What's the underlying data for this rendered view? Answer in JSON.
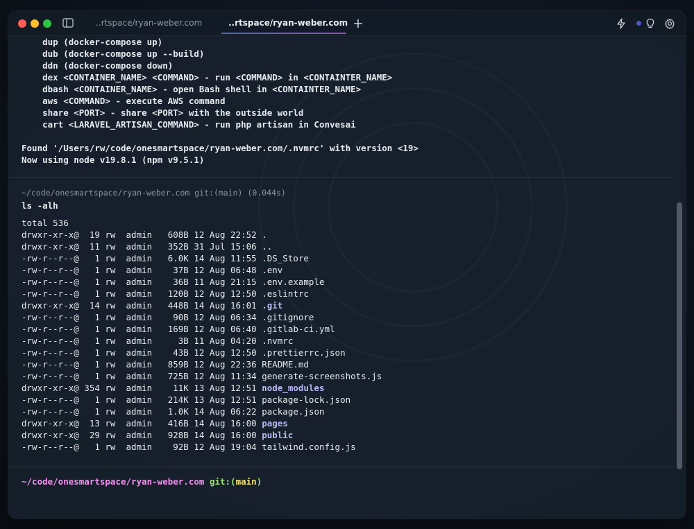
{
  "tabs": [
    {
      "label": "..rtspace/ryan-weber.com",
      "active": false
    },
    {
      "label": "..rtspace/ryan-weber.com",
      "active": true
    }
  ],
  "icons": {
    "sidebar": "sidebar-toggle-icon",
    "add_tab": "plus-icon",
    "right": [
      "lightning-bolt-icon",
      "status-dot-icon",
      "lightbulb-icon",
      "gear-icon"
    ]
  },
  "colors": {
    "prompt_path": "#f58ff0",
    "prompt_git": "#9be36b",
    "prompt_branch": "#f2e37a",
    "directory": "#b9b8f2",
    "tab_underline_start": "#3b6be8",
    "tab_underline_end": "#b23be8"
  },
  "aliases": [
    "    dup (docker-compose up)",
    "    dub (docker-compose up --build)",
    "    ddn (docker-compose down)",
    "    dex <CONTAINER_NAME> <COMMAND> - run <COMMAND> in <CONTAINTER_NAME>",
    "    dbash <CONTAINER_NAME> - open Bash shell in <CONTAINTER_NAME>",
    "    aws <COMMAND> - execute AWS command",
    "    share <PORT> - share <PORT> with the outside world",
    "    cart <LARAVEL_ARTISAN_COMMAND> - run php artisan in Convesai"
  ],
  "nvm": [
    "Found '/Users/rw/code/onesmartspace/ryan-weber.com/.nvmrc' with version <19>",
    "Now using node v19.8.1 (npm v9.5.1)"
  ],
  "block": {
    "meta": "~/code/onesmartspace/ryan-weber.com git:(main) (0.044s)",
    "command": "ls -alh",
    "total": "total 536",
    "rows": [
      {
        "prefix": "drwxr-xr-x@  19 rw  admin   608B 12 Aug 22:52 ",
        "name": ".",
        "dir": false
      },
      {
        "prefix": "drwxr-xr-x@  11 rw  admin   352B 31 Jul 15:06 ",
        "name": "..",
        "dir": false
      },
      {
        "prefix": "-rw-r--r--@   1 rw  admin   6.0K 14 Aug 11:55 ",
        "name": ".DS_Store",
        "dir": false
      },
      {
        "prefix": "-rw-r--r--@   1 rw  admin    37B 12 Aug 06:48 ",
        "name": ".env",
        "dir": false
      },
      {
        "prefix": "-rw-r--r--@   1 rw  admin    36B 11 Aug 21:15 ",
        "name": ".env.example",
        "dir": false
      },
      {
        "prefix": "-rw-r--r--@   1 rw  admin   120B 12 Aug 12:50 ",
        "name": ".eslintrc",
        "dir": false
      },
      {
        "prefix": "drwxr-xr-x@  14 rw  admin   448B 14 Aug 16:01 ",
        "name": ".git",
        "dir": true
      },
      {
        "prefix": "-rw-r--r--@   1 rw  admin    90B 12 Aug 06:34 ",
        "name": ".gitignore",
        "dir": false
      },
      {
        "prefix": "-rw-r--r--@   1 rw  admin   169B 12 Aug 06:40 ",
        "name": ".gitlab-ci.yml",
        "dir": false
      },
      {
        "prefix": "-rw-r--r--@   1 rw  admin     3B 11 Aug 04:20 ",
        "name": ".nvmrc",
        "dir": false
      },
      {
        "prefix": "-rw-r--r--@   1 rw  admin    43B 12 Aug 12:50 ",
        "name": ".prettierrc.json",
        "dir": false
      },
      {
        "prefix": "-rw-r--r--@   1 rw  admin   859B 12 Aug 22:36 ",
        "name": "README.md",
        "dir": false
      },
      {
        "prefix": "-rw-r--r--@   1 rw  admin   725B 12 Aug 11:34 ",
        "name": "generate-screenshots.js",
        "dir": false
      },
      {
        "prefix": "drwxr-xr-x@ 354 rw  admin    11K 13 Aug 12:51 ",
        "name": "node_modules",
        "dir": true
      },
      {
        "prefix": "-rw-r--r--@   1 rw  admin   214K 13 Aug 12:51 ",
        "name": "package-lock.json",
        "dir": false
      },
      {
        "prefix": "-rw-r--r--@   1 rw  admin   1.0K 14 Aug 06:22 ",
        "name": "package.json",
        "dir": false
      },
      {
        "prefix": "drwxr-xr-x@  13 rw  admin   416B 14 Aug 16:00 ",
        "name": "pages",
        "dir": true
      },
      {
        "prefix": "drwxr-xr-x@  29 rw  admin   928B 14 Aug 16:00 ",
        "name": "public",
        "dir": true
      },
      {
        "prefix": "-rw-r--r--@   1 rw  admin    92B 12 Aug 19:04 ",
        "name": "tailwind.config.js",
        "dir": false
      }
    ]
  },
  "prompt": {
    "path": "~/code/onesmartspace/ryan-weber.com",
    "git": "git:(",
    "branch": "main",
    "git_close": ")"
  }
}
